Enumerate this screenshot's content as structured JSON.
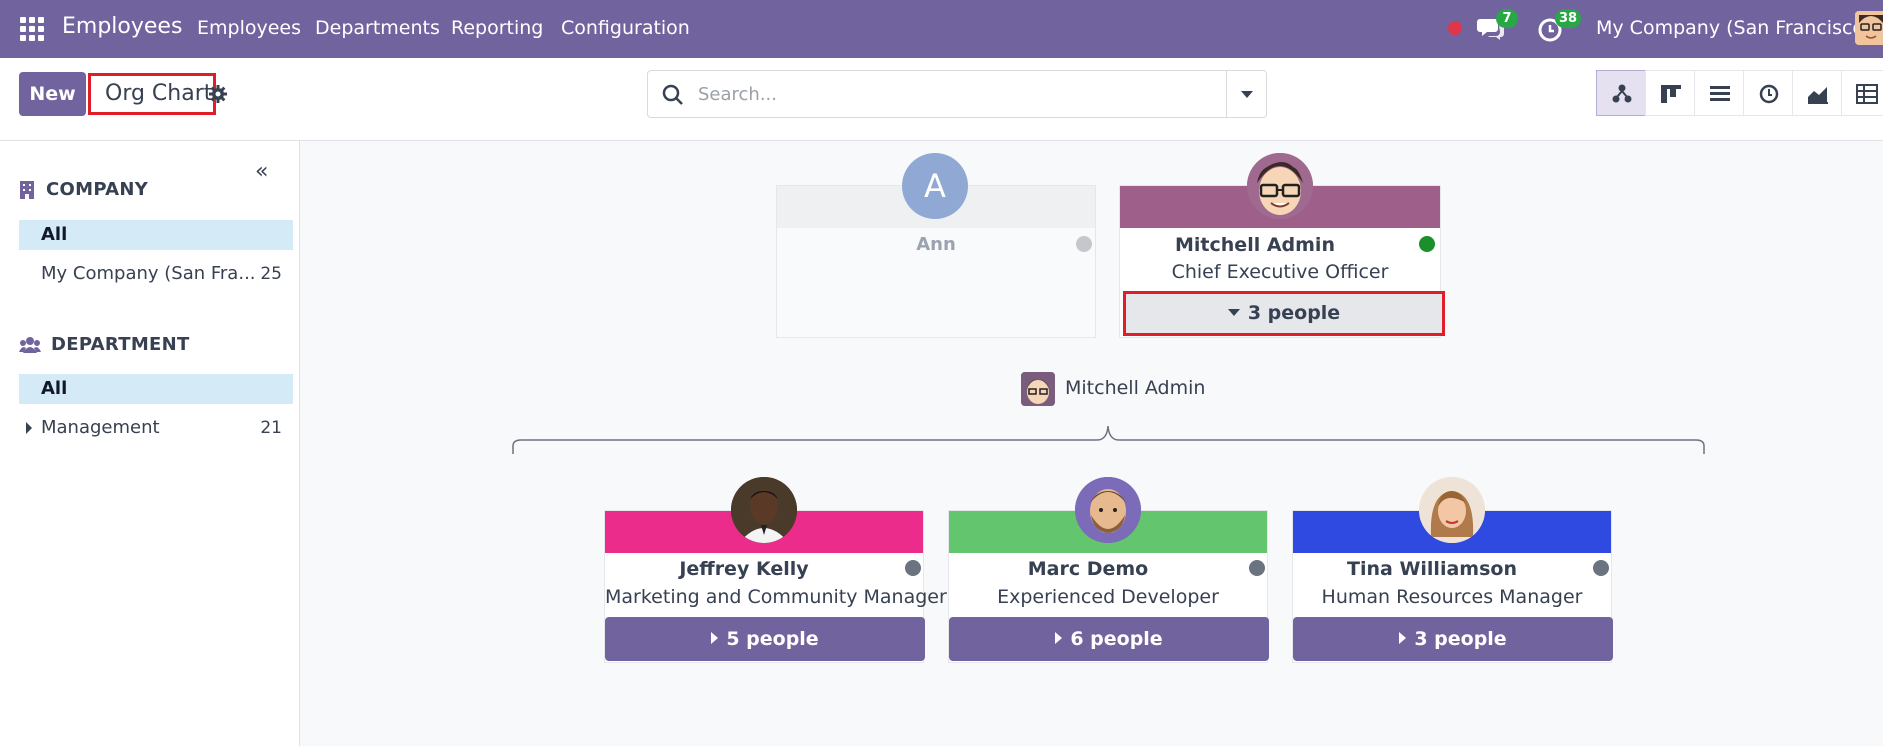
{
  "navbar": {
    "app_name": "Employees",
    "menu": [
      "Employees",
      "Departments",
      "Reporting",
      "Configuration"
    ],
    "messages_count": "7",
    "activities_count": "38",
    "company": "My Company (San Francisco)"
  },
  "control_panel": {
    "new_label": "New",
    "breadcrumb_title": "Org Chart",
    "search_placeholder": "Search..."
  },
  "sidebar": {
    "company_heading": "COMPANY",
    "company_all": "All",
    "company_item": "My Company (San Fra...",
    "company_item_count": "25",
    "department_heading": "DEPARTMENT",
    "department_all": "All",
    "department_item": "Management",
    "department_item_count": "21"
  },
  "org_chart": {
    "ann": {
      "initial": "A",
      "name": "Ann"
    },
    "ceo": {
      "name": "Mitchell Admin",
      "job": "Chief Executive Officer",
      "people": "3 people",
      "band_color": "#9e5f8a",
      "status_color": "#1a8f2b"
    },
    "manager_label": "Mitchell Admin",
    "reports": [
      {
        "name": "Jeffrey Kelly",
        "job": "Marketing and Community Manager",
        "people": "5 people",
        "band_color": "#ec2c8a"
      },
      {
        "name": "Marc Demo",
        "job": "Experienced Developer",
        "people": "6 people",
        "band_color": "#63c56e"
      },
      {
        "name": "Tina Williamson",
        "job": "Human Resources Manager",
        "people": "3 people",
        "band_color": "#2e4ae0"
      }
    ]
  },
  "colors": {
    "brand": "#71639e",
    "highlight_border": "#e01e2a",
    "sidebar_selected": "#d5eaf7"
  }
}
